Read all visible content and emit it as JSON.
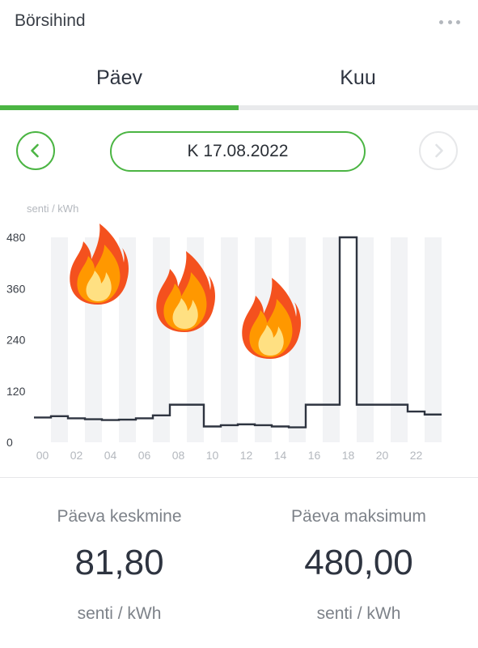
{
  "header": {
    "title": "Börsihind",
    "more_icon": "more-horizontal-icon"
  },
  "tabs": [
    {
      "label": "Päev",
      "active": true
    },
    {
      "label": "Kuu",
      "active": false
    }
  ],
  "date_nav": {
    "prev_icon": "chevron-left-icon",
    "next_icon": "chevron-right-icon",
    "date": "K 17.08.2022"
  },
  "colors": {
    "accent": "#4bb543",
    "line": "#2e3440",
    "stripe": "#f2f3f5",
    "axis_text": "#3a3f47",
    "x_tick_text": "#b4b8be"
  },
  "chart_data": {
    "type": "line",
    "step": true,
    "ylabel": "senti / kWh",
    "ylim": [
      0,
      480
    ],
    "yticks": [
      0,
      120,
      240,
      360,
      480
    ],
    "x": [
      0,
      1,
      2,
      3,
      4,
      5,
      6,
      7,
      8,
      9,
      10,
      11,
      12,
      13,
      14,
      15,
      16,
      17,
      18,
      19,
      20,
      21,
      22,
      23
    ],
    "xtick_labels": [
      "00",
      "02",
      "04",
      "06",
      "08",
      "10",
      "12",
      "14",
      "16",
      "18",
      "20",
      "22"
    ],
    "xtick_positions": [
      0,
      2,
      4,
      6,
      8,
      10,
      12,
      14,
      16,
      18,
      20,
      22
    ],
    "series": [
      {
        "values": [
          58,
          61,
          56,
          54,
          52,
          53,
          56,
          63,
          88,
          88,
          37,
          40,
          42,
          40,
          37,
          35,
          88,
          88,
          480,
          88,
          88,
          88,
          72,
          65
        ]
      }
    ],
    "annotations": [
      "fire-icon",
      "fire-icon",
      "fire-icon"
    ]
  },
  "stats": {
    "average": {
      "label": "Päeva keskmine",
      "value": "81,80",
      "unit": "senti / kWh"
    },
    "maximum": {
      "label": "Päeva maksimum",
      "value": "480,00",
      "unit": "senti / kWh"
    }
  }
}
